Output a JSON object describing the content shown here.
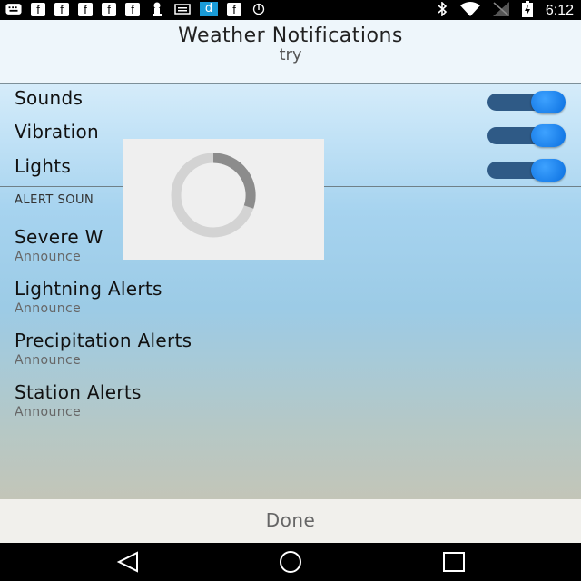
{
  "status_bar": {
    "left_icons": [
      "keyboard-icon",
      "facebook-icon",
      "facebook-icon",
      "facebook-icon",
      "facebook-icon",
      "facebook-icon",
      "nomad-icon",
      "mail-icon",
      "dolphin-icon",
      "facebook-icon",
      "sync-icon"
    ],
    "facebook_glyph": "f",
    "dolphin_glyph": "d",
    "right_icons": [
      "bluetooth-icon",
      "wifi-icon",
      "signal-icon",
      "battery-charging-icon"
    ],
    "time": "6:12"
  },
  "header": {
    "title": "Weather Notifications",
    "subtitle": "try"
  },
  "toggles": [
    {
      "label": "Sounds",
      "on": true
    },
    {
      "label": "Vibration",
      "on": true
    },
    {
      "label": "Lights",
      "on": true
    }
  ],
  "section_header": "ALERT SOUN",
  "alert_items": [
    {
      "title": "Severe W",
      "subtitle": "Announce"
    },
    {
      "title": "Lightning Alerts",
      "subtitle": "Announce"
    },
    {
      "title": "Precipitation Alerts",
      "subtitle": "Announce"
    },
    {
      "title": "Station Alerts",
      "subtitle": "Announce"
    }
  ],
  "footer": {
    "done_label": "Done"
  },
  "nav_bar": {
    "buttons": [
      "back-icon",
      "home-icon",
      "recents-icon"
    ]
  },
  "colors": {
    "switch_track": "#2f5a86",
    "switch_thumb": "#0a6fe0",
    "spinner_progress": "#8c8c8c",
    "spinner_track": "#d3d3d3"
  }
}
